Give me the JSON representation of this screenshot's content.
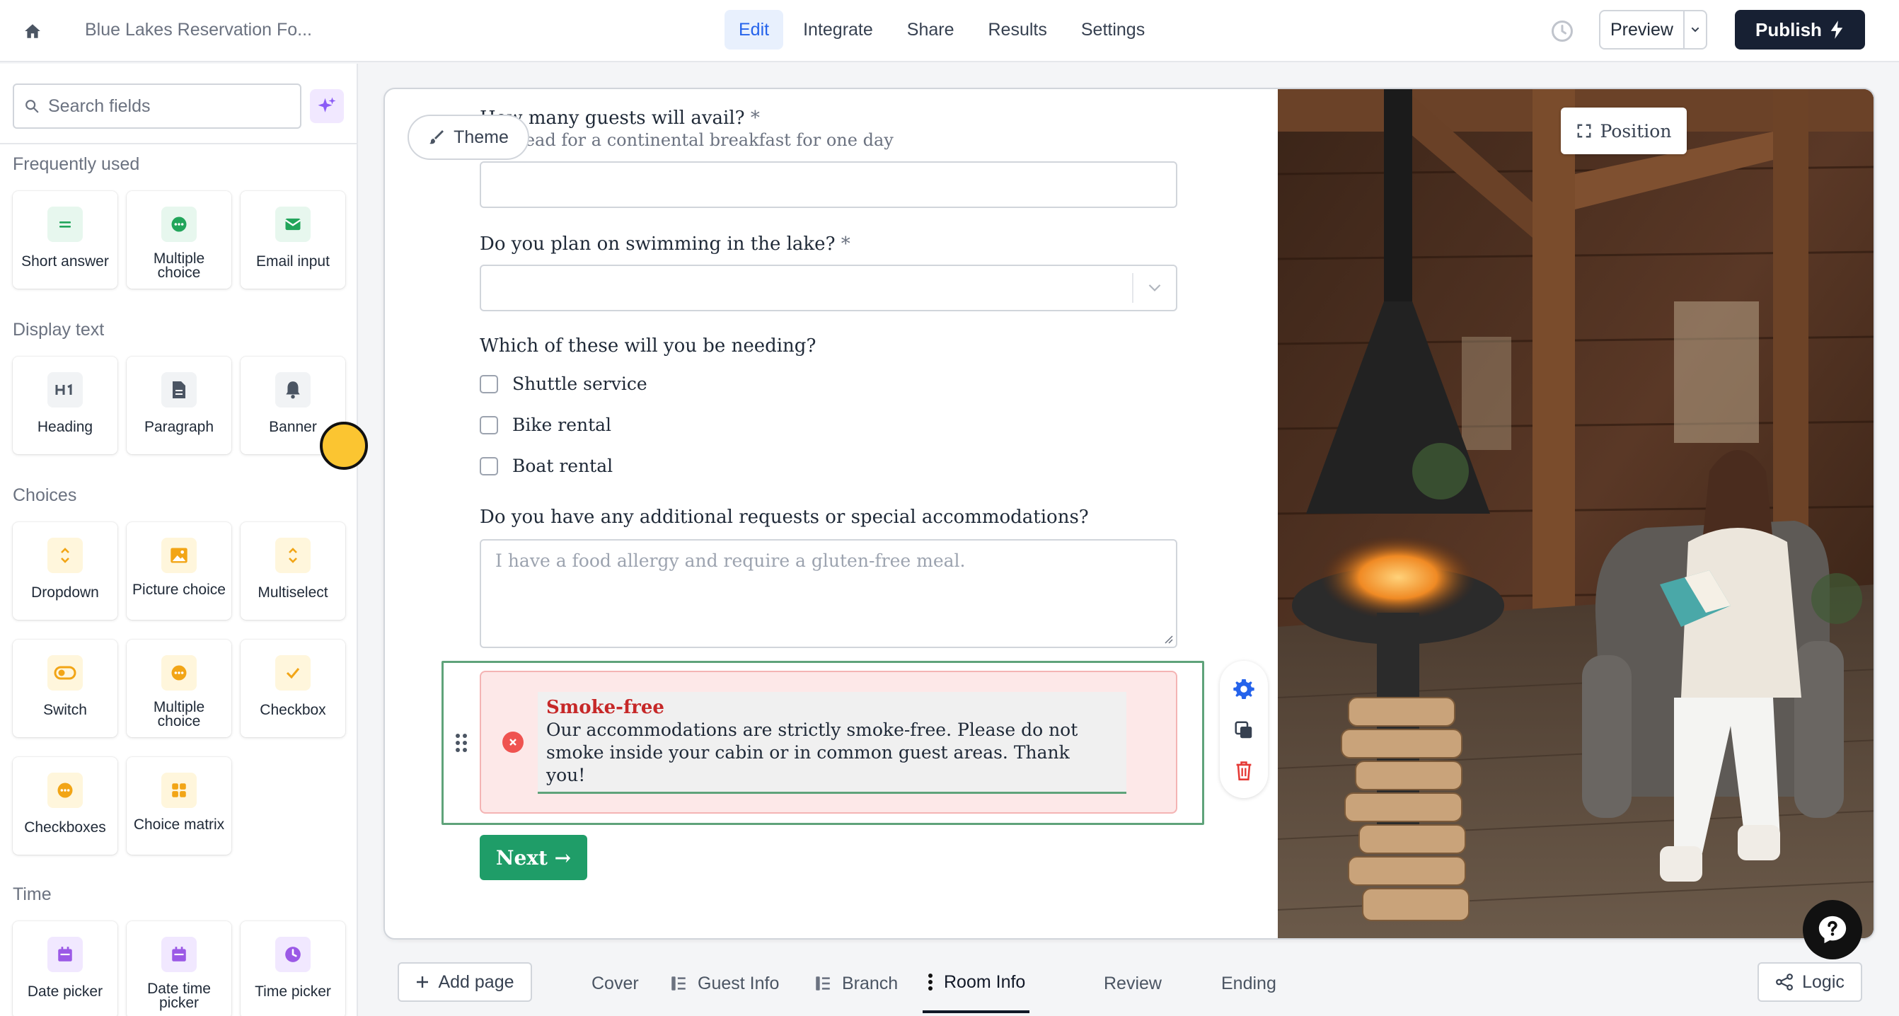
{
  "topbar": {
    "form_title": "Blue Lakes Reservation Fo...",
    "tabs": [
      {
        "label": "Edit",
        "active": true
      },
      {
        "label": "Integrate",
        "active": false
      },
      {
        "label": "Share",
        "active": false
      },
      {
        "label": "Results",
        "active": false
      },
      {
        "label": "Settings",
        "active": false
      }
    ],
    "preview_label": "Preview",
    "publish_label": "Publish"
  },
  "sidebar": {
    "search_placeholder": "Search fields",
    "sections": [
      {
        "label": "Frequently used",
        "items": [
          "Short answer",
          "Multiple choice",
          "Email input"
        ]
      },
      {
        "label": "Display text",
        "items": [
          "Heading",
          "Paragraph",
          "Banner"
        ]
      },
      {
        "label": "Choices",
        "items": [
          "Dropdown",
          "Picture choice",
          "Multiselect",
          "Switch",
          "Multiple choice",
          "Checkbox",
          "Checkboxes",
          "Choice matrix"
        ]
      },
      {
        "label": "Time",
        "items": [
          "Date picker",
          "Date time picker",
          "Time picker"
        ]
      }
    ]
  },
  "canvas": {
    "theme_label": "Theme",
    "position_label": "Position",
    "q1": {
      "label": "How many guests will avail?",
      "required_mark": "*",
      "help": "Per head for a continental breakfast for one day"
    },
    "q2": {
      "label": "Do you plan on swimming in the lake?",
      "required_mark": "*"
    },
    "q3": {
      "label": "Which of these will you be needing?",
      "options": [
        "Shuttle service",
        "Bike rental",
        "Boat rental"
      ]
    },
    "q4": {
      "label": "Do you have any additional requests or special accommodations?",
      "placeholder": "I have a food allergy and require a gluten-free meal."
    },
    "banner": {
      "title": "Smoke-free",
      "text": "Our accommodations are strictly smoke-free. Please do not smoke inside your cabin or in common guest areas. Thank you!"
    },
    "next_label": "Next →"
  },
  "pagebar": {
    "add_page_label": "Add page",
    "pages": [
      {
        "label": "Cover",
        "active": false
      },
      {
        "label": "Guest Info",
        "active": false
      },
      {
        "label": "Branch",
        "active": false
      },
      {
        "label": "Room Info",
        "active": true
      },
      {
        "label": "Review",
        "active": false
      },
      {
        "label": "Ending",
        "active": false
      }
    ],
    "logic_label": "Logic"
  }
}
